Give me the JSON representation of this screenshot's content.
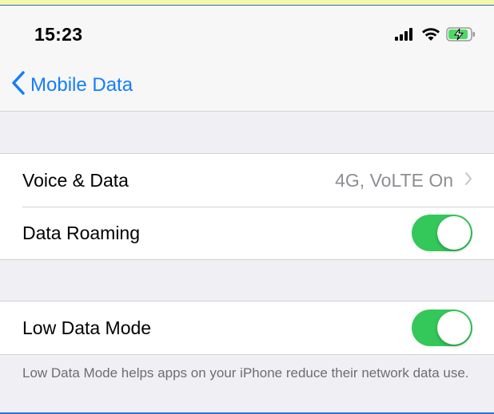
{
  "status_bar": {
    "time": "15:23",
    "signal_icon": "cellular-signal-icon",
    "wifi_icon": "wifi-icon",
    "battery_icon": "battery-charging-icon",
    "battery_color": "#4cd964"
  },
  "nav": {
    "back_label": "Mobile Data"
  },
  "settings": {
    "voice_data_label": "Voice & Data",
    "voice_data_value": "4G, VoLTE On",
    "data_roaming_label": "Data Roaming",
    "data_roaming_on": true,
    "low_data_mode_label": "Low Data Mode",
    "low_data_mode_on": true
  },
  "footer": {
    "low_data_note": "Low Data Mode helps apps on your iPhone reduce their network data use."
  },
  "colors": {
    "accent": "#147efb",
    "toggle_on": "#34c759"
  }
}
